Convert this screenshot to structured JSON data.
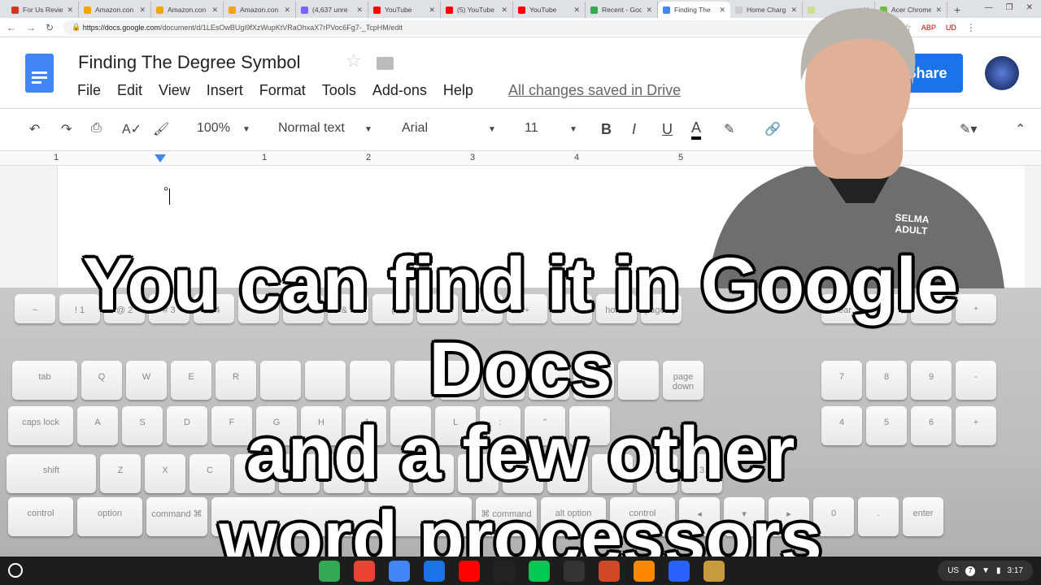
{
  "browser": {
    "tabs": [
      {
        "label": "For Us Revie",
        "color": "#d93025"
      },
      {
        "label": "Amazon.con",
        "color": "#f0a800"
      },
      {
        "label": "Amazon.con",
        "color": "#f0a800"
      },
      {
        "label": "Amazon.con",
        "color": "#f0a800"
      },
      {
        "label": "(4,637 unre",
        "color": "#7b61ff"
      },
      {
        "label": "YouTube",
        "color": "#ff0000"
      },
      {
        "label": "(5) YouTube",
        "color": "#ff0000"
      },
      {
        "label": "YouTube",
        "color": "#ff0000"
      },
      {
        "label": "Recent - Goo",
        "color": "#34a853"
      },
      {
        "label": "Finding The",
        "color": "#4285f4",
        "active": true
      },
      {
        "label": "Home Charg",
        "color": "#cccccc"
      },
      {
        "label": "",
        "color": "#cde08a"
      },
      {
        "label": "Acer Chrome",
        "color": "#6dbf3a"
      }
    ],
    "url_host": "https://docs.google.com",
    "url_path": "/document/d/1LEsOwBUgi9fXzWupKtVRaOhxaX7rPVoc6Fg7-_TcpHM/edit",
    "extensions": [
      "ABP",
      "UD"
    ]
  },
  "docs": {
    "title": "Finding The Degree Symbol",
    "menu": [
      "File",
      "Edit",
      "View",
      "Insert",
      "Format",
      "Tools",
      "Add-ons",
      "Help"
    ],
    "save_status": "All changes saved in Drive",
    "share_label": "Share",
    "toolbar": {
      "zoom": "100%",
      "style": "Normal text",
      "font": "Arial",
      "size": "11",
      "bold": "B",
      "italic": "I",
      "underline": "U",
      "text_color": "A"
    },
    "ruler": [
      "1",
      "1",
      "2",
      "3",
      "4",
      "5"
    ],
    "content": "°"
  },
  "caption": {
    "lines": [
      "You can find it in Google Docs",
      "and a few other",
      "word processors"
    ]
  },
  "keyboard": {
    "rows": [
      [
        "~",
        "!\n1",
        "@\n2",
        "#\n3",
        "$\n4",
        "%\n5",
        "^",
        "&\n7",
        "(",
        "",
        "-",
        "+",
        "",
        "home",
        "page up",
        "clear",
        "=",
        "/",
        "*"
      ],
      [
        "tab",
        "Q",
        "W",
        "E",
        "R",
        "",
        "",
        "",
        "",
        "",
        "",
        "",
        "",
        "",
        "page down",
        "7",
        "8",
        "9",
        "-"
      ],
      [
        "caps lock",
        "A",
        "S",
        "D",
        "F",
        "G",
        "H",
        "J",
        "",
        "L",
        ":",
        "\"",
        "",
        "4",
        "5",
        "6",
        "+"
      ],
      [
        "shift",
        "Z",
        "X",
        "C",
        "",
        "",
        "",
        "",
        "",
        "",
        "",
        "",
        "1",
        "2",
        "3"
      ],
      [
        "control",
        "option",
        "command ⌘",
        "",
        "⌘ command",
        "alt option",
        "control",
        "◂",
        "▾",
        "▸",
        "0",
        ".",
        "enter"
      ]
    ]
  },
  "shelf": {
    "apps": [
      "chrome",
      "gmail",
      "docs",
      "files",
      "youtube",
      "pluto",
      "play-store",
      "video",
      "powerpoint",
      "vlc",
      "globe",
      "game"
    ],
    "locale": "US",
    "notifications": "7",
    "time": "3:17"
  },
  "person_shirt_text": "SELMA ADULT"
}
